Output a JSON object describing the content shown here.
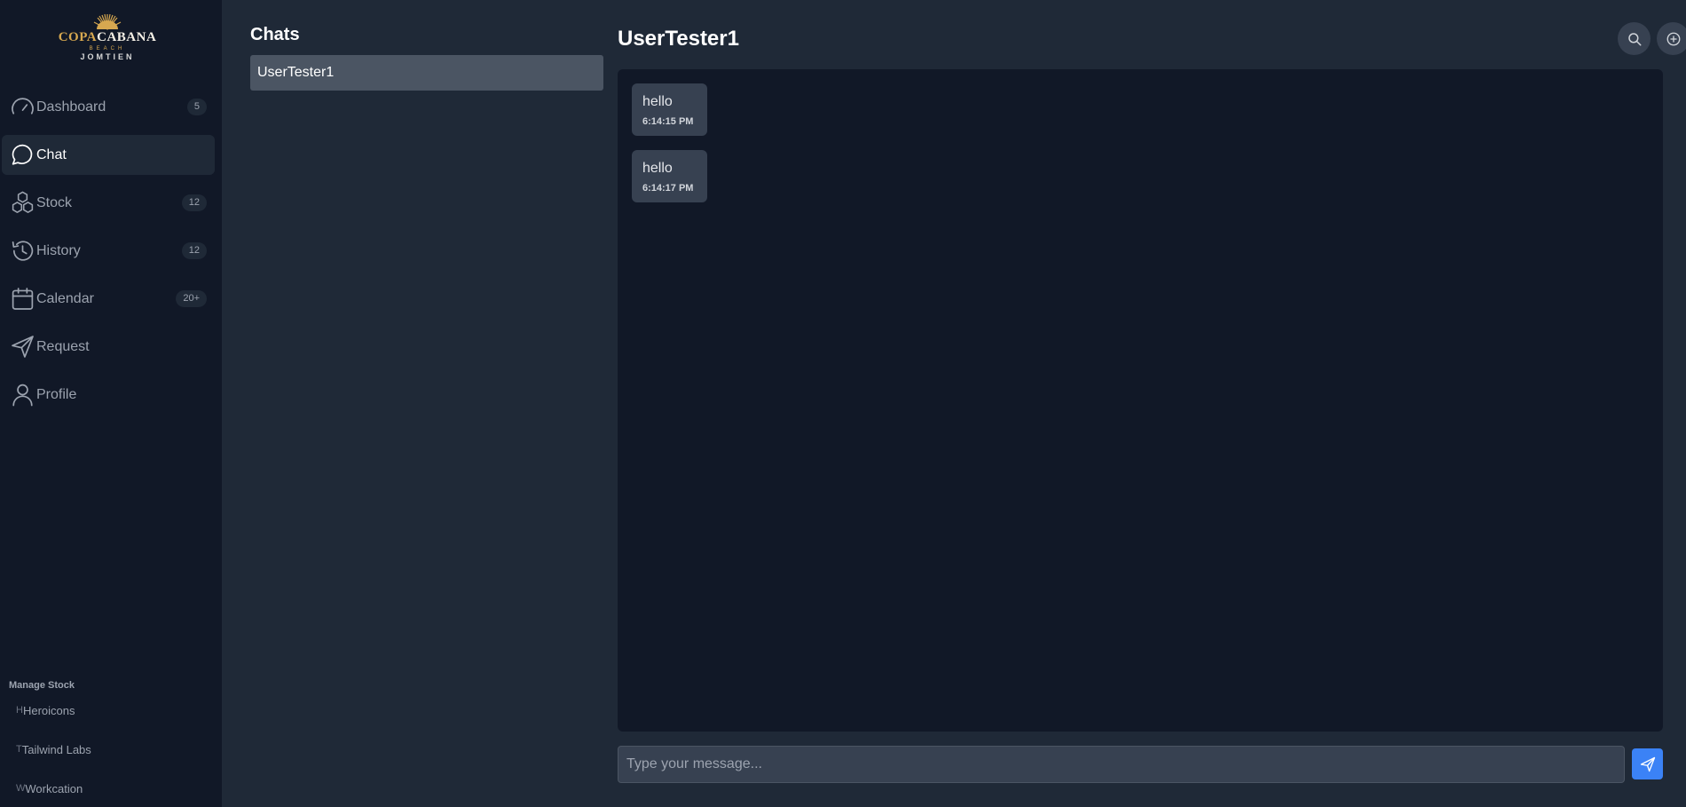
{
  "brand": {
    "logo_main_a": "COPA",
    "logo_main_b": "CABANA",
    "logo_sub1": "BEACH",
    "logo_sub2": "JOMTIEN"
  },
  "sidebar": {
    "items": [
      {
        "label": "Dashboard",
        "icon": "dashboard-gauge-icon",
        "badge": "5",
        "active": false
      },
      {
        "label": "Chat",
        "icon": "chat-bubble-icon",
        "badge": "",
        "active": true
      },
      {
        "label": "Stock",
        "icon": "cubes-icon",
        "badge": "12",
        "active": false
      },
      {
        "label": "History",
        "icon": "history-clock-icon",
        "badge": "12",
        "active": false
      },
      {
        "label": "Calendar",
        "icon": "calendar-icon",
        "badge": "20+",
        "active": false
      },
      {
        "label": "Request",
        "icon": "paper-plane-icon",
        "badge": "",
        "active": false
      },
      {
        "label": "Profile",
        "icon": "user-icon",
        "badge": "",
        "active": false
      }
    ],
    "manage_title": "Manage Stock",
    "manage_items": [
      {
        "initial": "H",
        "label": "Heroicons"
      },
      {
        "initial": "T",
        "label": "Tailwind Labs"
      },
      {
        "initial": "W",
        "label": "Workcation"
      }
    ]
  },
  "chatlist": {
    "title": "Chats",
    "entries": [
      {
        "name": "UserTester1"
      }
    ]
  },
  "conversation": {
    "title": "UserTester1",
    "messages": [
      {
        "text": "hello",
        "time": "6:14:15 PM"
      },
      {
        "text": "hello",
        "time": "6:14:17 PM"
      }
    ],
    "input_placeholder": "Type your message...",
    "input_value": ""
  },
  "colors": {
    "sidebar_bg": "#111827",
    "page_bg": "#1f2937",
    "accent": "#3b82f6",
    "logo_gold": "#d7a850"
  }
}
